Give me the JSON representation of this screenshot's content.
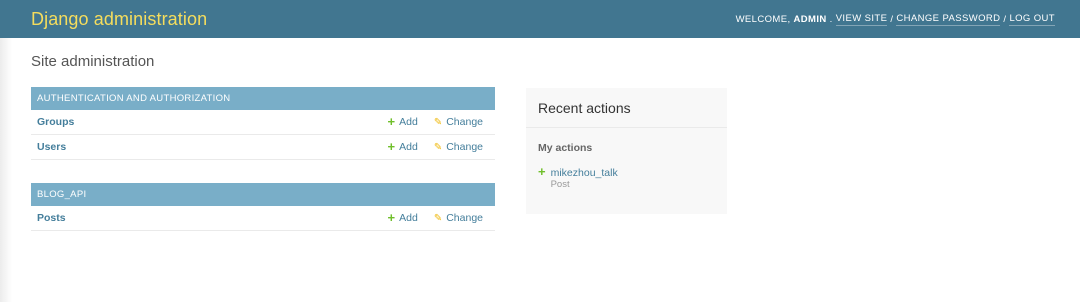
{
  "header": {
    "title": "Django administration",
    "welcome": "Welcome,",
    "username": "admin",
    "view_site": "View site",
    "change_password": "Change password",
    "log_out": "Log out",
    "separator": "/"
  },
  "page": {
    "title": "Site administration"
  },
  "apps": [
    {
      "name": "Authentication and Authorization",
      "models": [
        {
          "name": "Groups",
          "add": "Add",
          "change": "Change"
        },
        {
          "name": "Users",
          "add": "Add",
          "change": "Change"
        }
      ]
    },
    {
      "name": "Blog_API",
      "models": [
        {
          "name": "Posts",
          "add": "Add",
          "change": "Change"
        }
      ]
    }
  ],
  "sidebar": {
    "title": "Recent actions",
    "my_actions_heading": "My actions",
    "actions": [
      {
        "icon": "add-icon",
        "label": "mikezhou_talk",
        "type": "Post"
      }
    ]
  },
  "colors": {
    "header_bg": "#417690",
    "branding": "#f5dd5d",
    "caption_bg": "#79aec8",
    "link": "#447e9b",
    "add_green": "#70bf2b",
    "change_yellow": "#efb80b"
  }
}
